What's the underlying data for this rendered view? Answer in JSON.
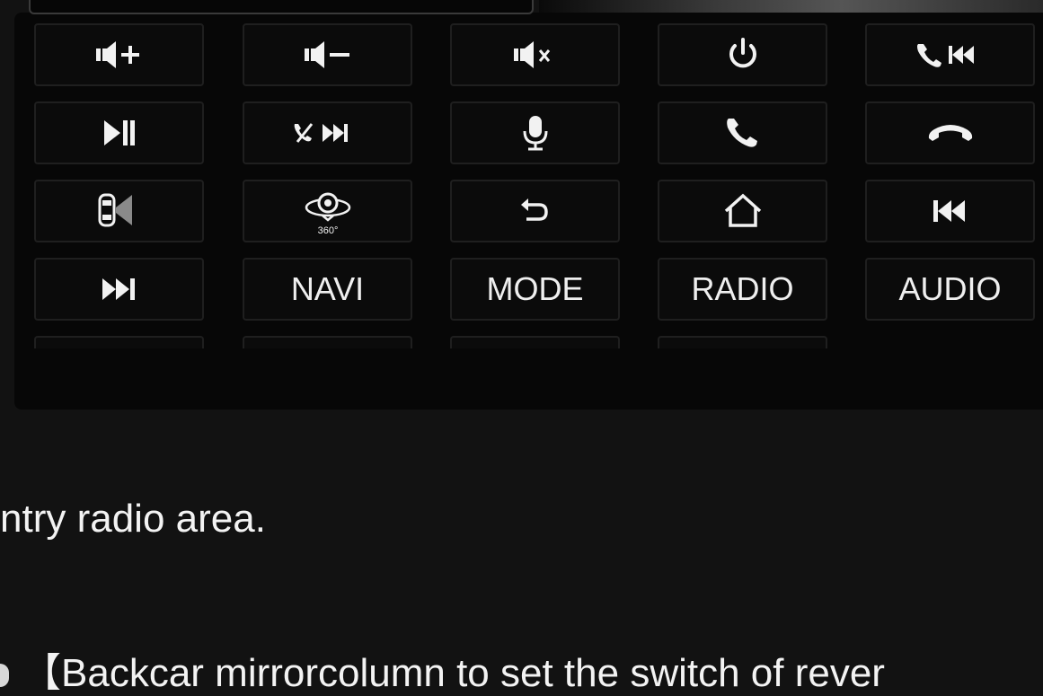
{
  "buttons": [
    {
      "id": "volume-up",
      "icon": "volume-up-icon"
    },
    {
      "id": "volume-down",
      "icon": "volume-down-icon"
    },
    {
      "id": "mute",
      "icon": "mute-icon"
    },
    {
      "id": "power",
      "icon": "power-icon"
    },
    {
      "id": "phone-previous",
      "icon": "phone-previous-icon"
    },
    {
      "id": "play-pause",
      "icon": "play-pause-icon"
    },
    {
      "id": "hangup-next",
      "icon": "hangup-next-icon"
    },
    {
      "id": "voice",
      "icon": "microphone-icon"
    },
    {
      "id": "answer-call",
      "icon": "phone-answer-icon"
    },
    {
      "id": "hang-up",
      "icon": "phone-hangup-icon"
    },
    {
      "id": "parking-radar",
      "icon": "parking-sensor-icon"
    },
    {
      "id": "camera-360",
      "icon": "camera-360-icon",
      "caption": "360°"
    },
    {
      "id": "back",
      "icon": "back-arrow-icon"
    },
    {
      "id": "home",
      "icon": "home-icon"
    },
    {
      "id": "previous-track",
      "icon": "previous-track-icon"
    },
    {
      "id": "next-track",
      "icon": "next-track-icon"
    },
    {
      "id": "navi",
      "label": "NAVI"
    },
    {
      "id": "mode",
      "label": "MODE"
    },
    {
      "id": "radio",
      "label": "RADIO"
    },
    {
      "id": "audio",
      "label": "AUDIO"
    }
  ],
  "text": {
    "line1": "ntry radio area.",
    "line2": "【Backcar mirrorcolumn to set the switch of rever"
  },
  "colors": {
    "background": "#121212",
    "panel": "#070707",
    "key_border": "#1f1f1f",
    "icon": "#f2f2f2"
  }
}
